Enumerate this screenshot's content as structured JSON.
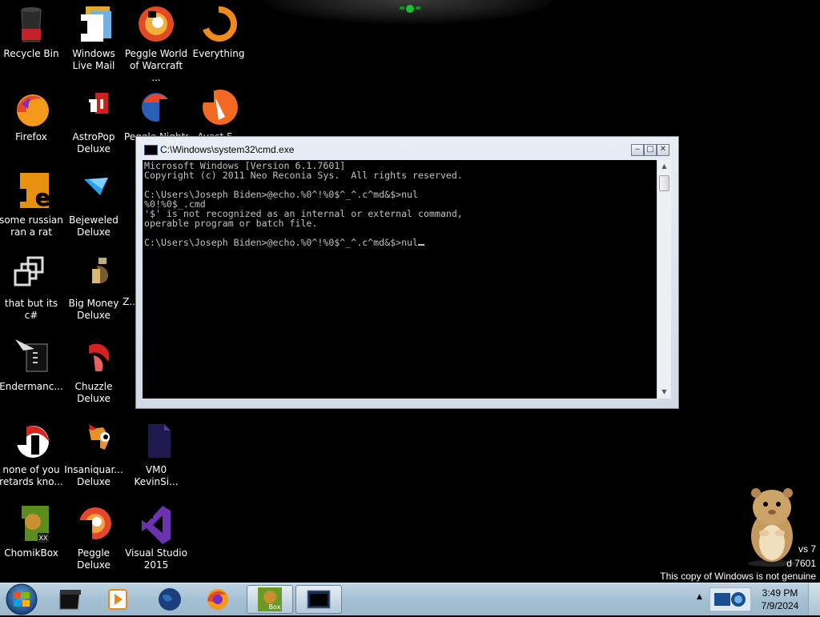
{
  "desktop": {
    "icons": [
      {
        "label": "Recycle Bin",
        "icon": "recycle-bin-icon"
      },
      {
        "label": "Windows Live Mail",
        "icon": "mail-icon"
      },
      {
        "label": "Peggle World of Warcraft ...",
        "icon": "peggle-wow-icon"
      },
      {
        "label": "Everything",
        "icon": "everything-search-icon"
      },
      {
        "label": "Firefox",
        "icon": "firefox-icon"
      },
      {
        "label": "AstroPop Deluxe",
        "icon": "astropop-icon"
      },
      {
        "label": "Peggle Nights",
        "icon": "peggle-nights-icon"
      },
      {
        "label": "Avast F...",
        "icon": "avast-icon"
      },
      {
        "label": "some russian ran a rat",
        "icon": "document-icon"
      },
      {
        "label": "Bejeweled Deluxe",
        "icon": "bejeweled-icon"
      },
      {
        "label": "that but its c#",
        "icon": "shortcut-icon"
      },
      {
        "label": "Big Money Deluxe",
        "icon": "big-money-icon"
      },
      {
        "label": "Z...",
        "icon": "app-icon"
      },
      {
        "label": "Endermanc...",
        "icon": "cursor-app-icon"
      },
      {
        "label": "Chuzzle Deluxe",
        "icon": "chuzzle-icon"
      },
      {
        "label": "none of you retards kno...",
        "icon": "app-icon"
      },
      {
        "label": "Insaniquar... Deluxe",
        "icon": "insaniquarium-icon"
      },
      {
        "label": "VM0 KevinSi...",
        "icon": "file-icon"
      },
      {
        "label": "ChomikBox",
        "icon": "chomikbox-icon"
      },
      {
        "label": "Peggle Deluxe",
        "icon": "peggle-icon"
      },
      {
        "label": "Visual Studio 2015",
        "icon": "visual-studio-icon"
      }
    ]
  },
  "cmd": {
    "title": "C:\\Windows\\system32\\cmd.exe",
    "lines": [
      "Microsoft Windows [Version 6.1.7601]",
      "Copyright (c) 2011 Neo Reconia Sys.  All rights reserved.",
      "",
      "C:\\Users\\Joseph Biden>@echo.%0^!%0$^_^.c^md&$>nul",
      "%0!%0$_.cmd",
      "'$' is not recognized as an internal or external command,",
      "operable program or batch file.",
      "",
      "C:\\Users\\Joseph Biden>@echo.%0^!%0$^_^.c^md&$>nul"
    ],
    "controls": {
      "minimize": "‒",
      "maximize": "□",
      "close": "✕"
    },
    "scroll_up": "▲",
    "scroll_down": "▼"
  },
  "watermark": {
    "line1": "vs 7",
    "line2": "d 7601",
    "line3": "This copy of Windows is not genuine"
  },
  "taskbar": {
    "items": [
      {
        "name": "taskbar-recycle-app",
        "icon": "black-box-icon"
      },
      {
        "name": "taskbar-media-player",
        "icon": "media-player-icon"
      },
      {
        "name": "taskbar-globe",
        "icon": "globe-icon"
      },
      {
        "name": "taskbar-firefox",
        "icon": "firefox-icon"
      },
      {
        "name": "taskbar-chomikbox",
        "icon": "chomikbox-icon",
        "text": "Box"
      },
      {
        "name": "taskbar-cmd",
        "icon": "cmd-icon"
      }
    ],
    "clock": {
      "time": "3:49 PM",
      "date": "7/9/2024"
    },
    "tray_arrow": "▲"
  }
}
